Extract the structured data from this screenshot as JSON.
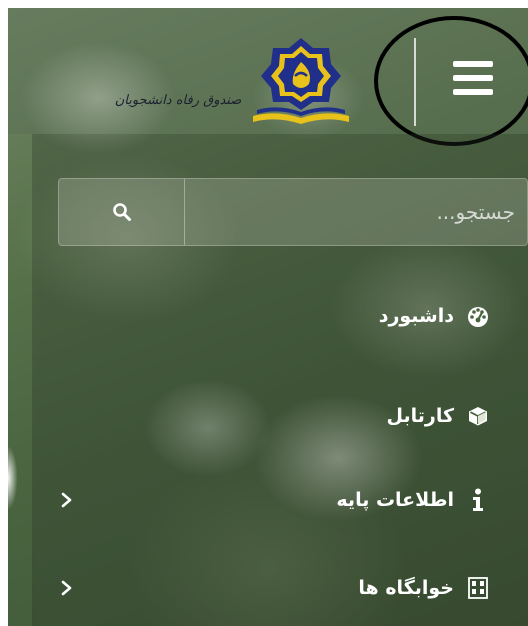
{
  "brand": {
    "logo_caption": "صندوق رفاه دانشجویان",
    "colors": {
      "navy": "#1f2f8a",
      "gold": "#e8c21a"
    }
  },
  "header": {
    "menu_toggle_icon": "hamburger-icon"
  },
  "search": {
    "placeholder": "جستجو...",
    "value": "",
    "icon": "search-icon"
  },
  "nav": {
    "items": [
      {
        "label": "داشبورد",
        "icon": "dashboard-gauge-icon",
        "has_submenu": false
      },
      {
        "label": "کارتابل",
        "icon": "cube-icon",
        "has_submenu": false
      },
      {
        "label": "اطلاعات پایه",
        "icon": "info-icon",
        "has_submenu": true
      },
      {
        "label": "خوابگاه ها",
        "icon": "dormitory-icon",
        "has_submenu": true
      }
    ]
  }
}
